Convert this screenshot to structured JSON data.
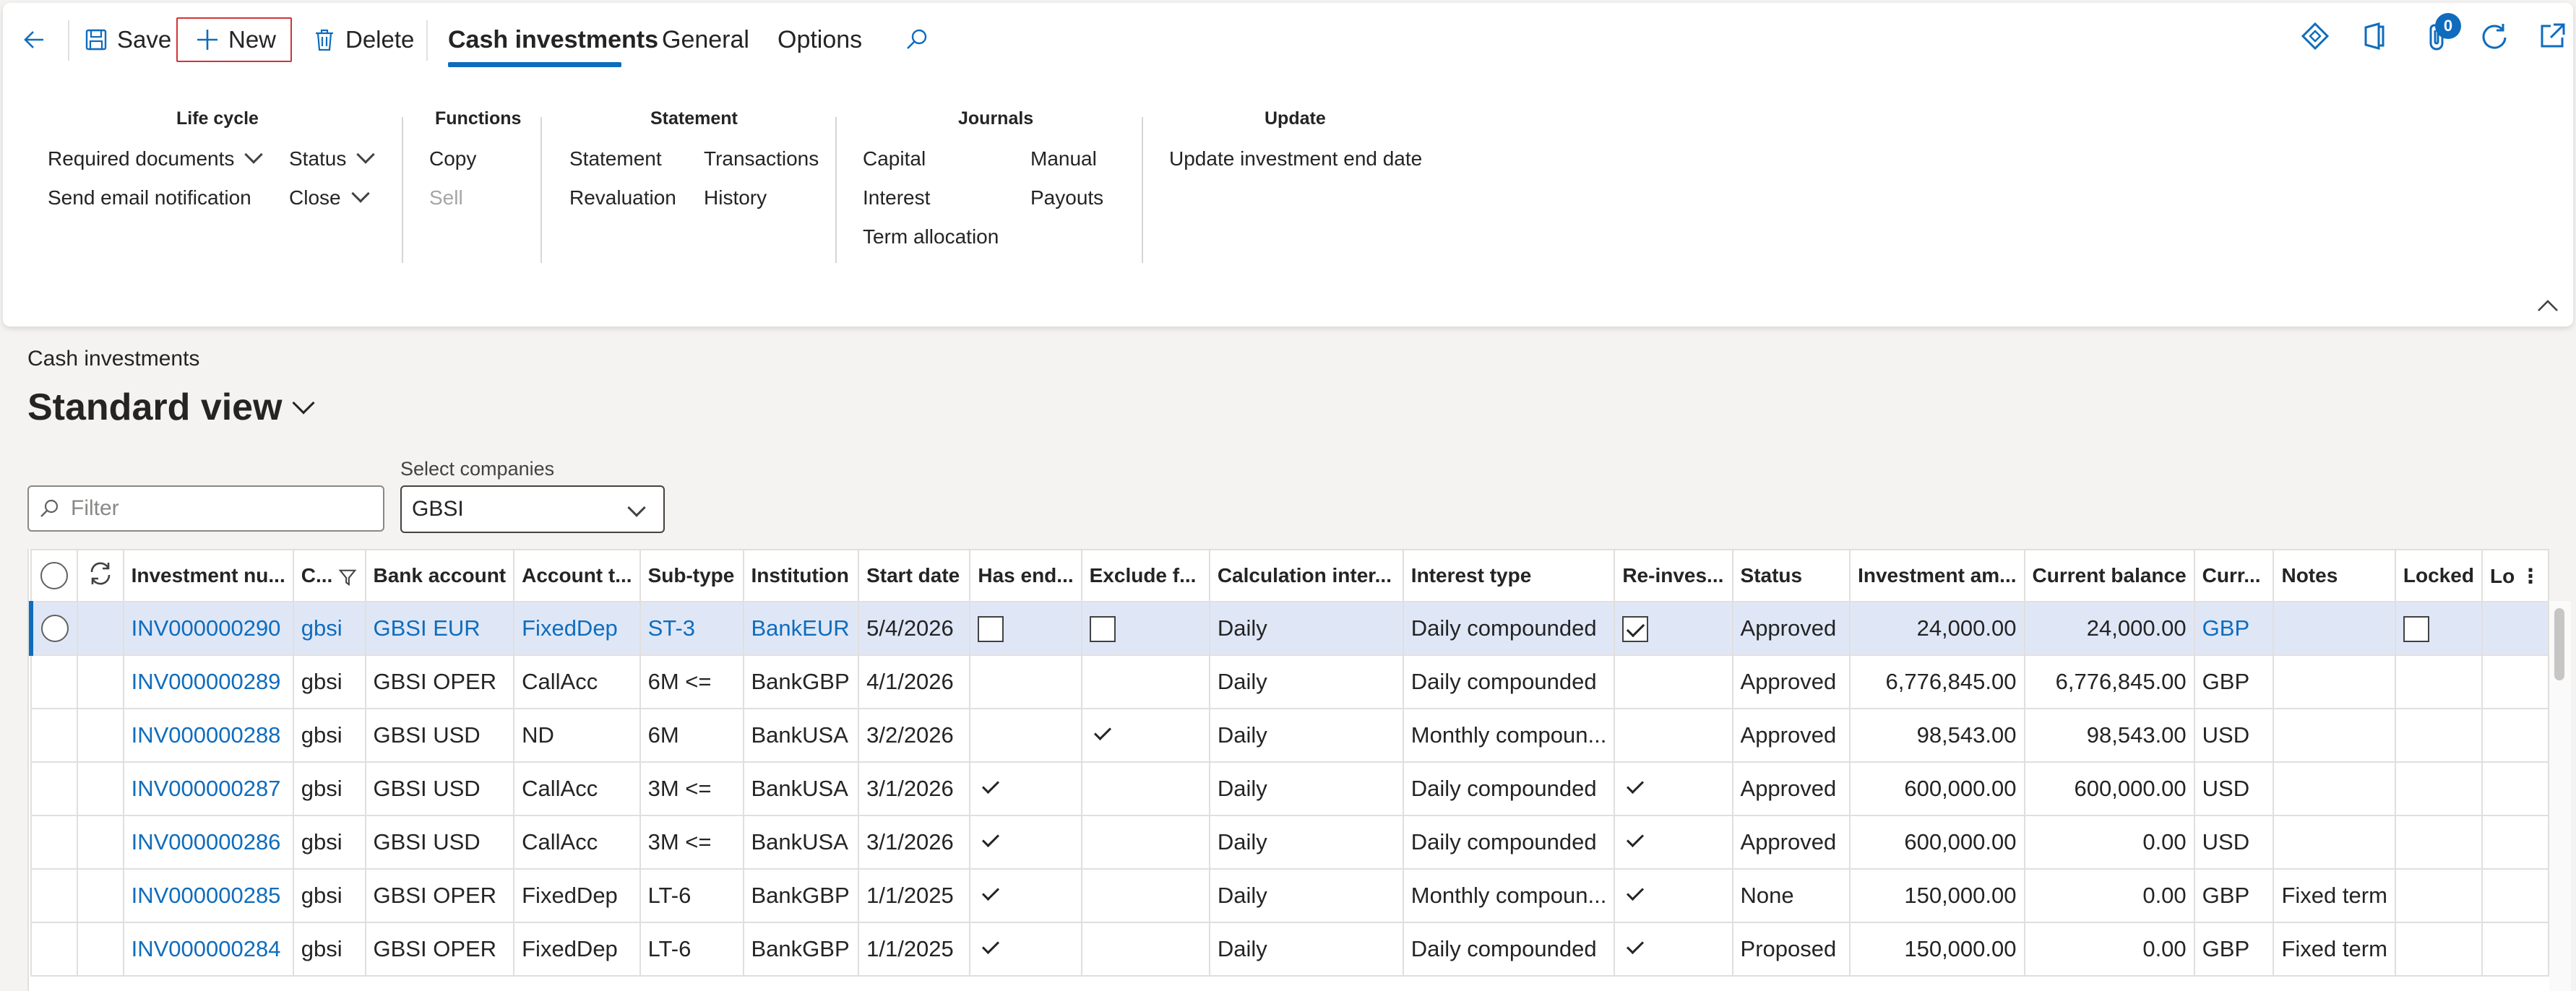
{
  "toolbar": {
    "save_label": "Save",
    "new_label": "New",
    "delete_label": "Delete"
  },
  "tabs": [
    {
      "label": "Cash investments",
      "active": true
    },
    {
      "label": "General",
      "active": false
    },
    {
      "label": "Options",
      "active": false
    }
  ],
  "notifications_count": "0",
  "ribbon": {
    "life_cycle": {
      "title": "Life cycle",
      "required_documents": "Required documents",
      "send_email": "Send email notification",
      "status": "Status",
      "close": "Close"
    },
    "functions": {
      "title": "Functions",
      "copy": "Copy",
      "sell": "Sell"
    },
    "statement": {
      "title": "Statement",
      "statement": "Statement",
      "revaluation": "Revaluation",
      "transactions": "Transactions",
      "history": "History"
    },
    "journals": {
      "title": "Journals",
      "capital": "Capital",
      "interest": "Interest",
      "term_allocation": "Term allocation",
      "manual": "Manual",
      "payouts": "Payouts"
    },
    "update": {
      "title": "Update",
      "update_end_date": "Update investment end date"
    }
  },
  "page": {
    "breadcrumb": "Cash investments",
    "view_title": "Standard view",
    "filter_placeholder": "Filter",
    "select_companies_label": "Select companies",
    "select_companies_value": "GBSI"
  },
  "grid": {
    "columns": [
      "Investment nu...",
      "C...",
      "Bank account",
      "Account t...",
      "Sub-type",
      "Institution",
      "Start date",
      "Has end...",
      "Exclude f...",
      "Calculation inter...",
      "Interest type",
      "Re-inves...",
      "Status",
      "Investment am...",
      "Current balance",
      "Curr...",
      "Notes",
      "Locked",
      "Lo"
    ],
    "rows": [
      {
        "id": "INV000000290",
        "company": "gbsi",
        "bank": "GBSI EUR",
        "acct_type": "FixedDep",
        "subtype": "ST-3",
        "institution": "BankEUR",
        "start": "5/4/2026",
        "has_end": "box",
        "exclude": "box",
        "calc": "Daily",
        "interest": "Daily compounded",
        "reinvest": "checked",
        "status": "Approved",
        "amount": "24,000.00",
        "balance": "24,000.00",
        "currency": "GBP",
        "notes": "",
        "locked": "box",
        "selected": true
      },
      {
        "id": "INV000000289",
        "company": "gbsi",
        "bank": "GBSI OPER",
        "acct_type": "CallAcc",
        "subtype": "6M <=",
        "institution": "BankGBP",
        "start": "4/1/2026",
        "has_end": "",
        "exclude": "",
        "calc": "Daily",
        "interest": "Daily compounded",
        "reinvest": "",
        "status": "Approved",
        "amount": "6,776,845.00",
        "balance": "6,776,845.00",
        "currency": "GBP",
        "notes": "",
        "locked": "",
        "selected": false
      },
      {
        "id": "INV000000288",
        "company": "gbsi",
        "bank": "GBSI USD",
        "acct_type": "ND",
        "subtype": "6M",
        "institution": "BankUSA",
        "start": "3/2/2026",
        "has_end": "",
        "exclude": "tick",
        "calc": "Daily",
        "interest": "Monthly compoun...",
        "reinvest": "",
        "status": "Approved",
        "amount": "98,543.00",
        "balance": "98,543.00",
        "currency": "USD",
        "notes": "",
        "locked": "",
        "selected": false
      },
      {
        "id": "INV000000287",
        "company": "gbsi",
        "bank": "GBSI USD",
        "acct_type": "CallAcc",
        "subtype": "3M <=",
        "institution": "BankUSA",
        "start": "3/1/2026",
        "has_end": "tick",
        "exclude": "",
        "calc": "Daily",
        "interest": "Daily compounded",
        "reinvest": "tick",
        "status": "Approved",
        "amount": "600,000.00",
        "balance": "600,000.00",
        "currency": "USD",
        "notes": "",
        "locked": "",
        "selected": false
      },
      {
        "id": "INV000000286",
        "company": "gbsi",
        "bank": "GBSI USD",
        "acct_type": "CallAcc",
        "subtype": "3M <=",
        "institution": "BankUSA",
        "start": "3/1/2026",
        "has_end": "tick",
        "exclude": "",
        "calc": "Daily",
        "interest": "Daily compounded",
        "reinvest": "tick",
        "status": "Approved",
        "amount": "600,000.00",
        "balance": "0.00",
        "currency": "USD",
        "notes": "",
        "locked": "",
        "selected": false
      },
      {
        "id": "INV000000285",
        "company": "gbsi",
        "bank": "GBSI OPER",
        "acct_type": "FixedDep",
        "subtype": "LT-6",
        "institution": "BankGBP",
        "start": "1/1/2025",
        "has_end": "tick",
        "exclude": "",
        "calc": "Daily",
        "interest": "Monthly compoun...",
        "reinvest": "tick",
        "status": "None",
        "amount": "150,000.00",
        "balance": "0.00",
        "currency": "GBP",
        "notes": "Fixed term",
        "locked": "",
        "selected": false
      },
      {
        "id": "INV000000284",
        "company": "gbsi",
        "bank": "GBSI OPER",
        "acct_type": "FixedDep",
        "subtype": "LT-6",
        "institution": "BankGBP",
        "start": "1/1/2025",
        "has_end": "tick",
        "exclude": "",
        "calc": "Daily",
        "interest": "Daily compounded",
        "reinvest": "tick",
        "status": "Proposed",
        "amount": "150,000.00",
        "balance": "0.00",
        "currency": "GBP",
        "notes": "Fixed term",
        "locked": "",
        "selected": false
      }
    ]
  },
  "colors": {
    "accent": "#0f6cbd",
    "selected_row": "#dfe7f7",
    "new_button_border": "#d13438"
  },
  "icons": [
    "back-arrow-icon",
    "save-icon",
    "plus-icon",
    "trash-icon",
    "search-icon",
    "diamond-icon",
    "office-icon",
    "attachment-icon",
    "refresh-icon",
    "open-new-window-icon",
    "filter-icon",
    "funnel-icon",
    "chevron-down-icon",
    "chevron-up-icon"
  ]
}
